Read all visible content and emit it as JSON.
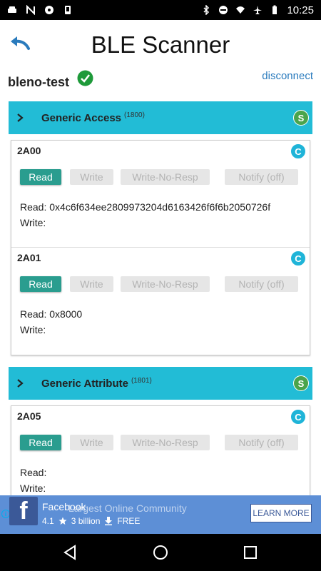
{
  "status_bar": {
    "time": "10:25",
    "left_icons": [
      "car-icon",
      "n-icon",
      "shield-icon",
      "phone-icon"
    ],
    "right_icons": [
      "bluetooth-icon",
      "minus-circle-icon",
      "wifi-icon",
      "airplane-icon",
      "battery-icon"
    ]
  },
  "header": {
    "title": "BLE Scanner"
  },
  "device": {
    "name": "bleno-test",
    "disconnect_label": "disconnect"
  },
  "services": [
    {
      "name": "Generic Access",
      "uuid": "(1800)",
      "badge": "S",
      "characteristics": [
        {
          "uuid": "2A00",
          "badge": "C",
          "buttons": {
            "read": "Read",
            "write": "Write",
            "write_no_resp": "Write-No-Resp",
            "notify": "Notify (off)"
          },
          "read_text": "Read: 0x4c6f634ee2809973204d6163426f6f6b2050726f",
          "write_text": "Write:"
        },
        {
          "uuid": "2A01",
          "badge": "C",
          "buttons": {
            "read": "Read",
            "write": "Write",
            "write_no_resp": "Write-No-Resp",
            "notify": "Notify (off)"
          },
          "read_text": "Read: 0x8000",
          "write_text": "Write:"
        }
      ]
    },
    {
      "name": "Generic Attribute",
      "uuid": "(1801)",
      "badge": "S",
      "characteristics": [
        {
          "uuid": "2A05",
          "badge": "C",
          "buttons": {
            "read": "Read",
            "write": "Write",
            "write_no_resp": "Write-No-Resp",
            "notify": "Notify (off)"
          },
          "read_text": "Read:",
          "write_text": "Write:"
        }
      ]
    }
  ],
  "ad": {
    "title": "Facebook",
    "ghost_text": "Largest Online Community",
    "rating": "4.1",
    "installs": "3 billion",
    "price": "FREE",
    "cta": "LEARN MORE",
    "logo_letter": "f"
  },
  "colors": {
    "service_bar": "#22bcd6",
    "read_button": "#2a9d8f",
    "service_badge": "#4aa44c",
    "char_badge": "#1fb4d8",
    "ad_background": "#5d8fd6"
  }
}
